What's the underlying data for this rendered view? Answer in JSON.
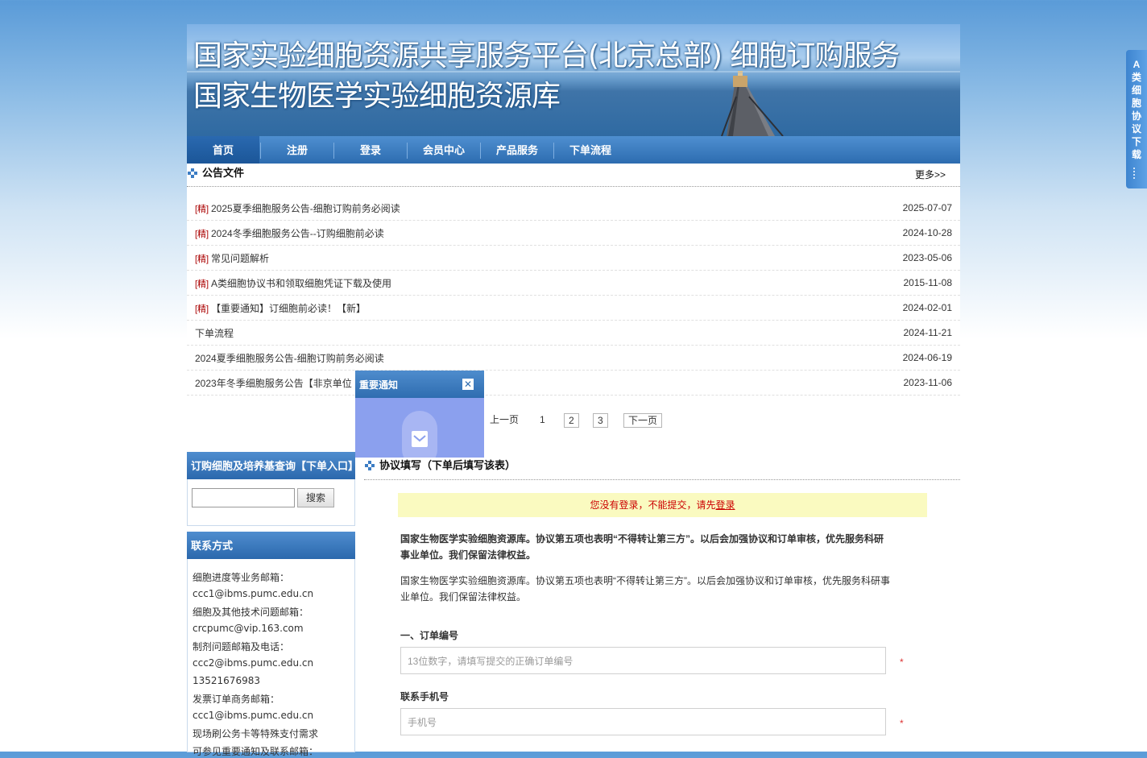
{
  "banner": {
    "title_line1": "国家实验细胞资源共享服务平台(北京总部) 细胞订购服务",
    "title_line2": "国家生物医学实验细胞资源库"
  },
  "nav": {
    "items": [
      {
        "label": "首页",
        "active": true
      },
      {
        "label": "注册"
      },
      {
        "label": "登录"
      },
      {
        "label": "会员中心"
      },
      {
        "label": "产品服务"
      },
      {
        "label": "下单流程"
      }
    ]
  },
  "announcements": {
    "heading": "公告文件",
    "more": "更多>>",
    "items": [
      {
        "tag": "[精]",
        "title": "2025夏季细胞服务公告-细胞订购前务必阅读",
        "date": "2025-07-07"
      },
      {
        "tag": "[精]",
        "title": "2024冬季细胞服务公告--订购细胞前必读",
        "date": "2024-10-28"
      },
      {
        "tag": "[精]",
        "title": "常见问题解析",
        "date": "2023-05-06"
      },
      {
        "tag": "[精]",
        "title": "A类细胞协议书和领取细胞凭证下载及使用",
        "date": "2015-11-08"
      },
      {
        "tag": "[精]",
        "title": "【重要通知】订细胞前必读！【新】",
        "date": "2024-02-01"
      },
      {
        "tag": "",
        "title": "下单流程",
        "date": "2024-11-21"
      },
      {
        "tag": "",
        "title": "2024夏季细胞服务公告-细胞订购前务必阅读",
        "date": "2024-06-19"
      },
      {
        "tag": "",
        "title": "2023年冬季细胞服务公告【非京单位",
        "date": "2023-11-06"
      }
    ],
    "pager": {
      "prev": "上一页",
      "pages": [
        "1",
        "2",
        "3"
      ],
      "next": "下一页"
    }
  },
  "popup": {
    "title": "重要通知",
    "close": "✕"
  },
  "order_search": {
    "heading": "订购细胞及培养基查询【下单入口】",
    "input_value": "",
    "button": "搜索"
  },
  "contact": {
    "heading": "联系方式",
    "lines": [
      "细胞进度等业务邮箱：",
      "ccc1@ibms.pumc.edu.cn",
      "细胞及其他技术问题邮箱：",
      "crcpumc@vip.163.com",
      "制剂问题邮箱及电话：",
      "ccc2@ibms.pumc.edu.cn",
      "13521676983",
      "发票订单商务邮箱：",
      "ccc1@ibms.pumc.edu.cn",
      "现场刷公务卡等特殊支付需求",
      "可参见重要通知及联系邮箱："
    ]
  },
  "agreement": {
    "heading": "协议填写（下单后填写该表）",
    "warning_text": "您没有登录，不能提交，请先",
    "warning_link": "登录",
    "para_bold": "国家生物医学实验细胞资源库。协议第五项也表明“不得转让第三方”。以后会加强协议和订单审核，优先服务科研事业单位。我们保留法律权益。",
    "para": "国家生物医学实验细胞资源库。协议第五项也表明“不得转让第三方”。以后会加强协议和订单审核，优先服务科研事业单位。我们保留法律权益。",
    "fields": [
      {
        "label": "一、订单编号",
        "placeholder": "13位数字，请填写提交的正确订单编号",
        "required": "*"
      },
      {
        "label": "联系手机号",
        "placeholder": "手机号",
        "required": "*"
      }
    ]
  },
  "side_tab": {
    "label": "A类细胞协议下载"
  }
}
